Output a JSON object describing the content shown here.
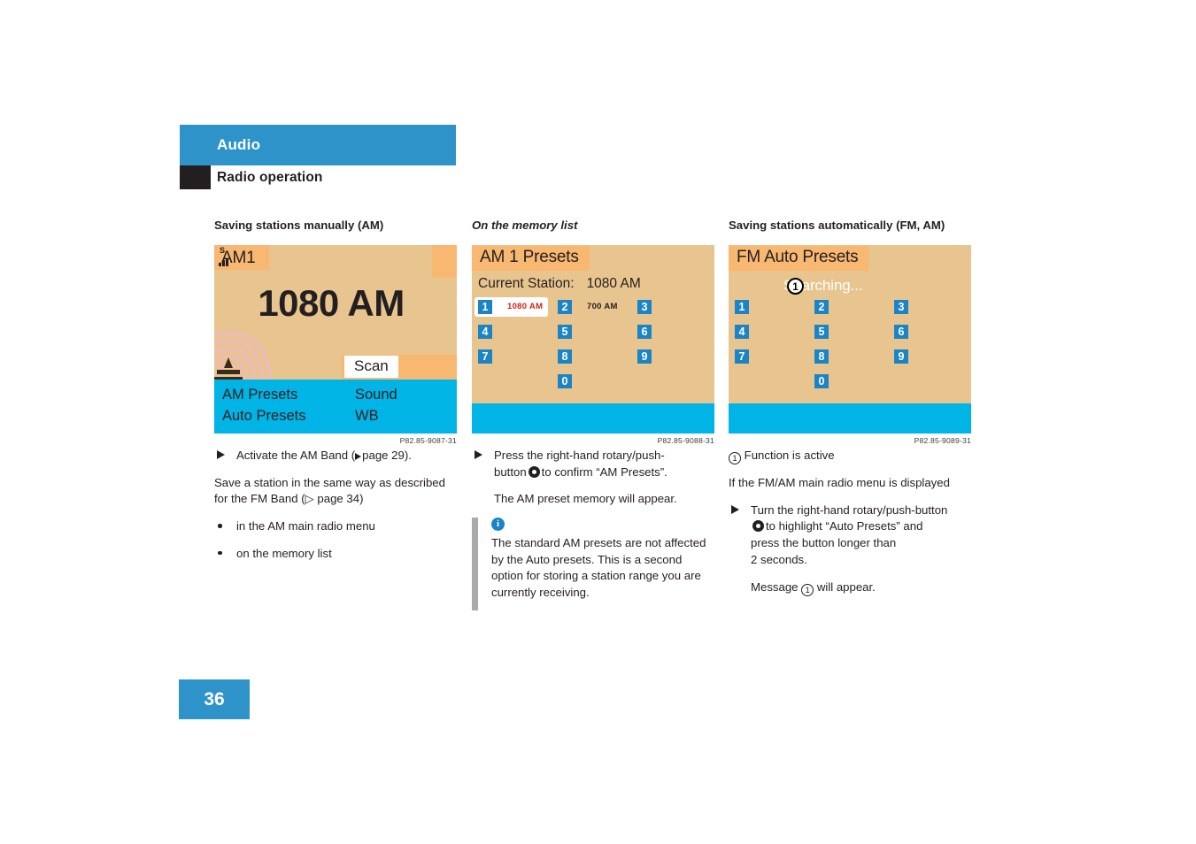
{
  "header": {
    "chapter": "Audio",
    "section": "Radio operation"
  },
  "page_number": "36",
  "columns": [
    {
      "title": "Saving stations manually (AM)",
      "caption": "P82.85-9087-31",
      "screen": {
        "type": "am-main",
        "band_tab": "AM1",
        "signal_label": "S",
        "frequency": "1080 AM",
        "scan_button": "Scan",
        "menu": [
          "AM Presets",
          "Sound",
          "Auto Presets",
          "WB"
        ]
      },
      "steps": [
        {
          "kind": "step",
          "text_before": "Activate the AM Band (",
          "ref": "page 29",
          "text_after": ")."
        },
        {
          "kind": "para",
          "text": "Save a station in the same way as described for the FM Band (▷ page 34)"
        },
        {
          "kind": "bullet",
          "text": "in the AM main radio menu"
        },
        {
          "kind": "bullet",
          "text": "on the memory list"
        }
      ]
    },
    {
      "title": "On the memory list",
      "caption": "P82.85-9088-31",
      "screen": {
        "type": "presets",
        "title": "AM 1 Presets",
        "current_station_label": "Current Station:",
        "current_station_value": "1080 AM",
        "presets": [
          {
            "number": "1",
            "station": "1080 AM",
            "selected": true
          },
          {
            "number": "2",
            "station": "700 AM",
            "selected": false
          },
          {
            "number": "3",
            "station": "",
            "selected": false
          },
          {
            "number": "4",
            "station": "",
            "selected": false
          },
          {
            "number": "5",
            "station": "",
            "selected": false
          },
          {
            "number": "6",
            "station": "",
            "selected": false
          },
          {
            "number": "7",
            "station": "",
            "selected": false
          },
          {
            "number": "8",
            "station": "",
            "selected": false
          },
          {
            "number": "9",
            "station": "",
            "selected": false
          },
          {
            "number": "0",
            "station": "",
            "selected": false
          }
        ]
      },
      "step_line1": "Press the right-hand rotary/push-",
      "step_line2_a": "button",
      "step_line2_b": "to confirm “AM Presets”.",
      "result": "The AM preset memory will appear.",
      "note": "The standard AM presets are not affected by the Auto presets. This is a second option for storing a station range you are currently receiving."
    },
    {
      "title": "Saving stations automatically (FM, AM)",
      "caption": "P82.85-9089-31",
      "screen": {
        "type": "presets",
        "title": "FM Auto Presets",
        "searching_label": "Searching...",
        "callout": "1",
        "presets": [
          {
            "number": "1",
            "station": "",
            "selected": false
          },
          {
            "number": "2",
            "station": "",
            "selected": false
          },
          {
            "number": "3",
            "station": "",
            "selected": false
          },
          {
            "number": "4",
            "station": "",
            "selected": false
          },
          {
            "number": "5",
            "station": "",
            "selected": false
          },
          {
            "number": "6",
            "station": "",
            "selected": false
          },
          {
            "number": "7",
            "station": "",
            "selected": false
          },
          {
            "number": "8",
            "station": "",
            "selected": false
          },
          {
            "number": "9",
            "station": "",
            "selected": false
          },
          {
            "number": "0",
            "station": "",
            "selected": false
          }
        ]
      },
      "legend_number": "1",
      "legend_text": "Function is active",
      "condition": "If the FM/AM main radio menu is displayed",
      "step_line1": "Turn the right-hand rotary/push-button",
      "step_line2_b": "to highlight “Auto Presets” and",
      "step_line3": "press the button longer than",
      "step_line4": "2 seconds.",
      "message_a": "Message",
      "message_ref": "1",
      "message_b": "will appear."
    }
  ],
  "colors": {
    "brand_blue": "#2e93c8",
    "screen_cyan": "#00b4e6",
    "screen_tan": "#e8c48e",
    "screen_orange": "#f8b871",
    "preset_blue": "#1b84c6",
    "station_red": "#cf2317"
  }
}
